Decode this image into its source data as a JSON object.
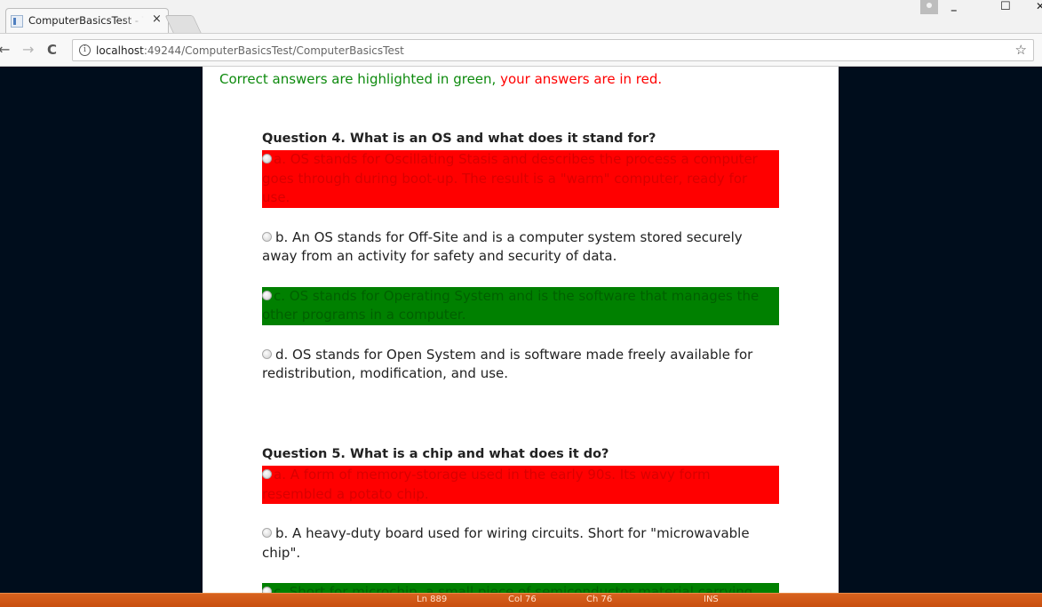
{
  "browser": {
    "tab_title": "ComputerBasicsTest - The",
    "tab_close": "×",
    "url_host": "localhost",
    "url_rest": ":49244/ComputerBasicsTest/ComputerBasicsTest",
    "back": "←",
    "forward": "→",
    "reload": "C",
    "info": "i",
    "star": "☆",
    "minimize": "–",
    "maximize": "☐",
    "close": "✕"
  },
  "page": {
    "note_correct": "Correct answers are highlighted in green,",
    "note_yours": " your answers are in red.",
    "questions": [
      {
        "title": "Question 4. What is an OS and what does it stand for?",
        "answers": [
          "a. OS stands for Oscillating Stasis and describes the process a computer goes through during boot-up. The result is a \"warm\" computer, ready for use.",
          "b. An OS stands for Off-Site and is a computer system stored securely away from an activity for safety and security of data.",
          "c. OS stands for Operating System and is the software that manages the other programs in a computer.",
          "d. OS stands for Open System and is software made freely available for redistribution, modification, and use."
        ]
      },
      {
        "title": "Question 5. What is a chip and what does it do?",
        "answers": [
          "a. A form of memory-storage used in the early 90s. Its wavy form resembled a potato chip.",
          "b. A heavy-duty board used for wiring circuits. Short for \"microwavable chip\".",
          "c. Short for microchip, a small piece of semiconductor material carrying"
        ]
      }
    ]
  },
  "statusbar": {
    "line": "Ln 889",
    "col": "Col 76",
    "ch": "Ch 76",
    "mode": "INS"
  },
  "colors": {
    "correct_highlight": "#008000",
    "wrong_highlight": "#ff0000",
    "note_green": "#0d8a0d",
    "note_red": "#ff0000",
    "background": "#000d1c",
    "statusbar": "#d05a18"
  }
}
